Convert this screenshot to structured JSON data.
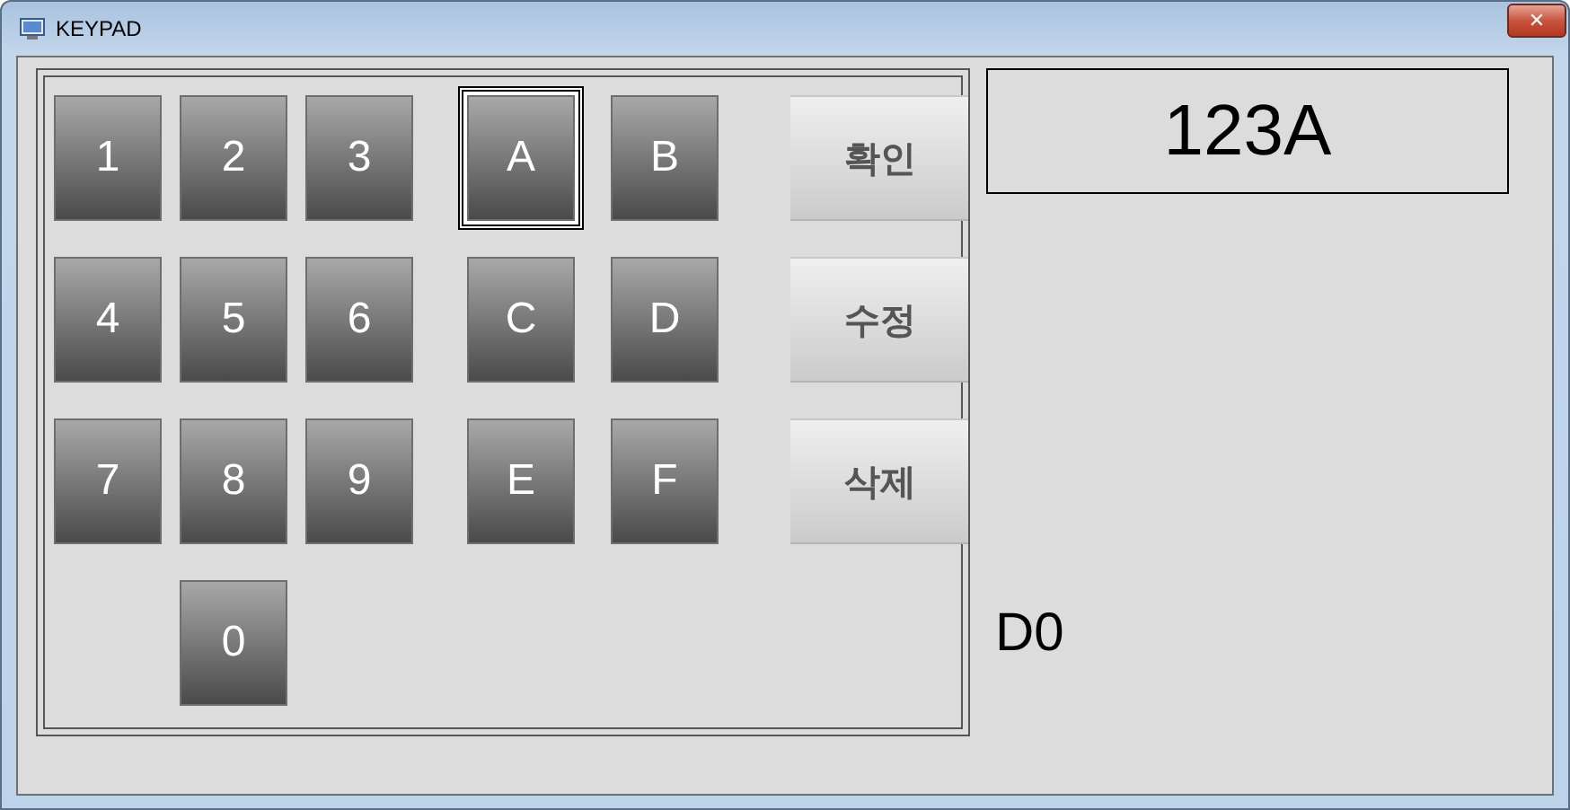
{
  "window": {
    "title": "KEYPAD",
    "close_label": "✕"
  },
  "digit_keys": [
    {
      "label": "1",
      "focused": false
    },
    {
      "label": "2",
      "focused": false
    },
    {
      "label": "3",
      "focused": false
    },
    {
      "label": "4",
      "focused": false
    },
    {
      "label": "5",
      "focused": false
    },
    {
      "label": "6",
      "focused": false
    },
    {
      "label": "7",
      "focused": false
    },
    {
      "label": "8",
      "focused": false
    },
    {
      "label": "9",
      "focused": false
    },
    {
      "label": "0",
      "focused": false
    }
  ],
  "hex_keys": [
    {
      "label": "A",
      "focused": true
    },
    {
      "label": "B",
      "focused": false
    },
    {
      "label": "C",
      "focused": false
    },
    {
      "label": "D",
      "focused": false
    },
    {
      "label": "E",
      "focused": false
    },
    {
      "label": "F",
      "focused": false
    }
  ],
  "action_buttons": [
    {
      "label": "확인"
    },
    {
      "label": "수정"
    },
    {
      "label": "삭제"
    }
  ],
  "display": {
    "value": "123A"
  },
  "address_label": "D0"
}
